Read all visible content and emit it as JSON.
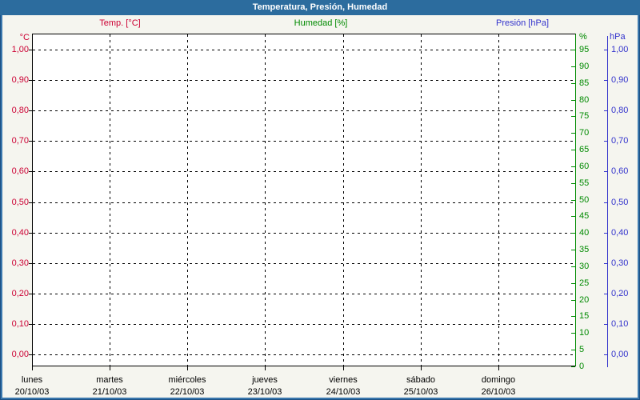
{
  "window": {
    "title": "Temperatura, Presión, Humedad"
  },
  "legend": {
    "items": [
      {
        "label": "Temp. [°C]",
        "color": "#CC0033"
      },
      {
        "label": "Humedad [%]",
        "color": "#008A00"
      },
      {
        "label": "Presión [hPa]",
        "color": "#3333CC"
      }
    ]
  },
  "chart_data": {
    "type": "line",
    "title": "Temperatura, Presión, Humedad",
    "legend_position": "top",
    "grid": true,
    "plot_background": "#FFFFFF",
    "frame_color": "#2C6C9E",
    "series": [
      {
        "name": "Temp. [°C]",
        "axis": "temperature",
        "color": "#CC0033",
        "values": []
      },
      {
        "name": "Humedad [%]",
        "axis": "humidity",
        "color": "#008A00",
        "values": []
      },
      {
        "name": "Presión [hPa]",
        "axis": "pressure",
        "color": "#3333CC",
        "values": []
      }
    ],
    "axes": {
      "temperature": {
        "side": "left",
        "unit": "°C",
        "color": "#CC0033",
        "min": 0,
        "max": 1,
        "tick_labels": [
          "1,00",
          "0,90",
          "0,80",
          "0,70",
          "0,60",
          "0,50",
          "0,40",
          "0,30",
          "0,20",
          "0,10",
          "0,00"
        ],
        "tick_values": [
          1,
          0.9,
          0.8,
          0.7,
          0.6,
          0.5,
          0.4,
          0.3,
          0.2,
          0.1,
          0
        ]
      },
      "humidity": {
        "side": "right-inner",
        "unit": "%",
        "color": "#008A00",
        "min": 0,
        "max": 95,
        "tick_labels": [
          "95",
          "90",
          "85",
          "80",
          "75",
          "70",
          "65",
          "60",
          "55",
          "50",
          "45",
          "40",
          "35",
          "30",
          "25",
          "20",
          "15",
          "10",
          "5",
          "0"
        ],
        "tick_values": [
          95,
          90,
          85,
          80,
          75,
          70,
          65,
          60,
          55,
          50,
          45,
          40,
          35,
          30,
          25,
          20,
          15,
          10,
          5,
          0
        ]
      },
      "pressure": {
        "side": "right-outer",
        "unit": "hPa",
        "color": "#3333CC",
        "min": 0,
        "max": 1,
        "tick_labels": [
          "1,00",
          "0,90",
          "0,80",
          "0,70",
          "0,60",
          "0,50",
          "0,40",
          "0,30",
          "0,20",
          "0,10",
          "0,00"
        ],
        "tick_values": [
          1,
          0.9,
          0.8,
          0.7,
          0.6,
          0.5,
          0.4,
          0.3,
          0.2,
          0.1,
          0
        ]
      }
    },
    "x_axis": {
      "days": [
        {
          "name": "lunes",
          "date": "20/10/03"
        },
        {
          "name": "martes",
          "date": "21/10/03"
        },
        {
          "name": "miércoles",
          "date": "22/10/03"
        },
        {
          "name": "jueves",
          "date": "23/10/03"
        },
        {
          "name": "viernes",
          "date": "24/10/03"
        },
        {
          "name": "sábado",
          "date": "25/10/03"
        },
        {
          "name": "domingo",
          "date": "26/10/03"
        }
      ]
    }
  }
}
